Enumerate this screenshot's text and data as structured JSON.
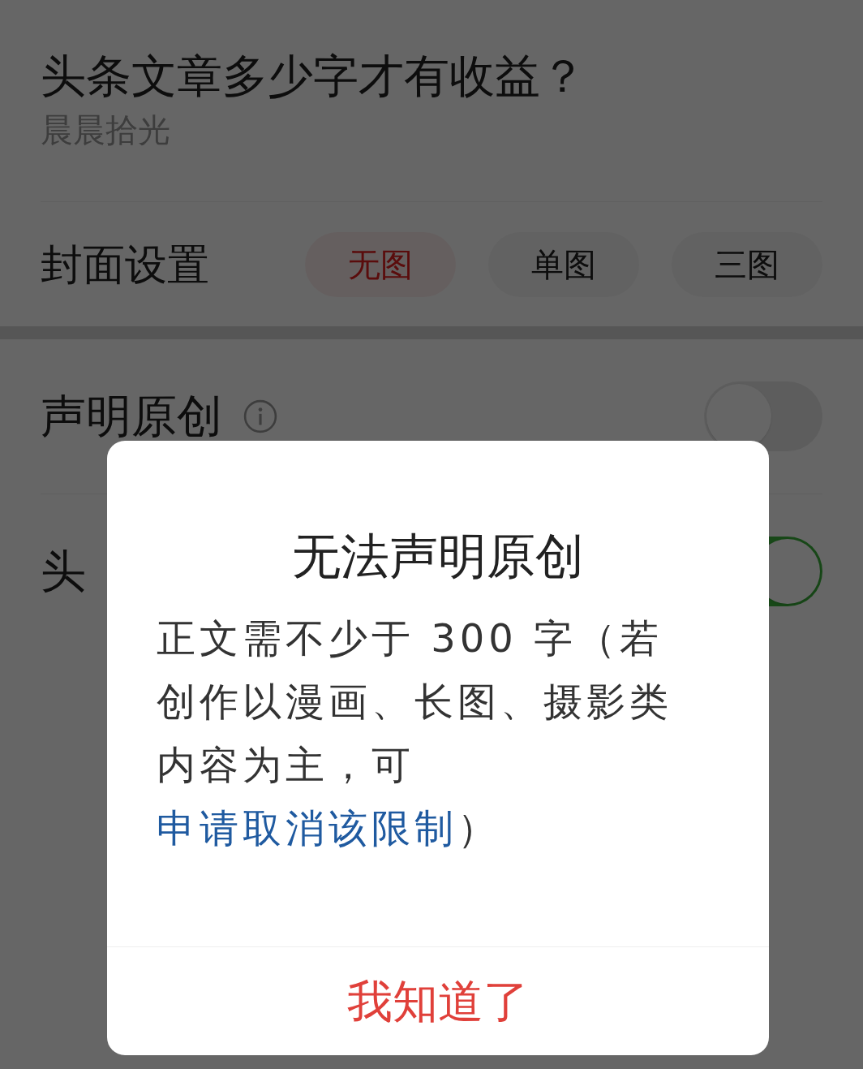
{
  "article": {
    "title": "头条文章多少字才有收益？",
    "author": "晨晨拾光"
  },
  "cover": {
    "label": "封面设置",
    "options": [
      {
        "label": "无图",
        "selected": true
      },
      {
        "label": "单图",
        "selected": false
      },
      {
        "label": "三图",
        "selected": false
      }
    ]
  },
  "settings": [
    {
      "label": "声明原创",
      "info": true,
      "on": false
    },
    {
      "label": "头",
      "info": false,
      "on": true
    }
  ],
  "dialog": {
    "title": "无法声明原创",
    "body_before": "正文需不少于 300 字（若创作以漫画、长图、摄影类内容为主，可",
    "link": "申请取消该限制",
    "body_after": "）",
    "button": "我知道了"
  }
}
